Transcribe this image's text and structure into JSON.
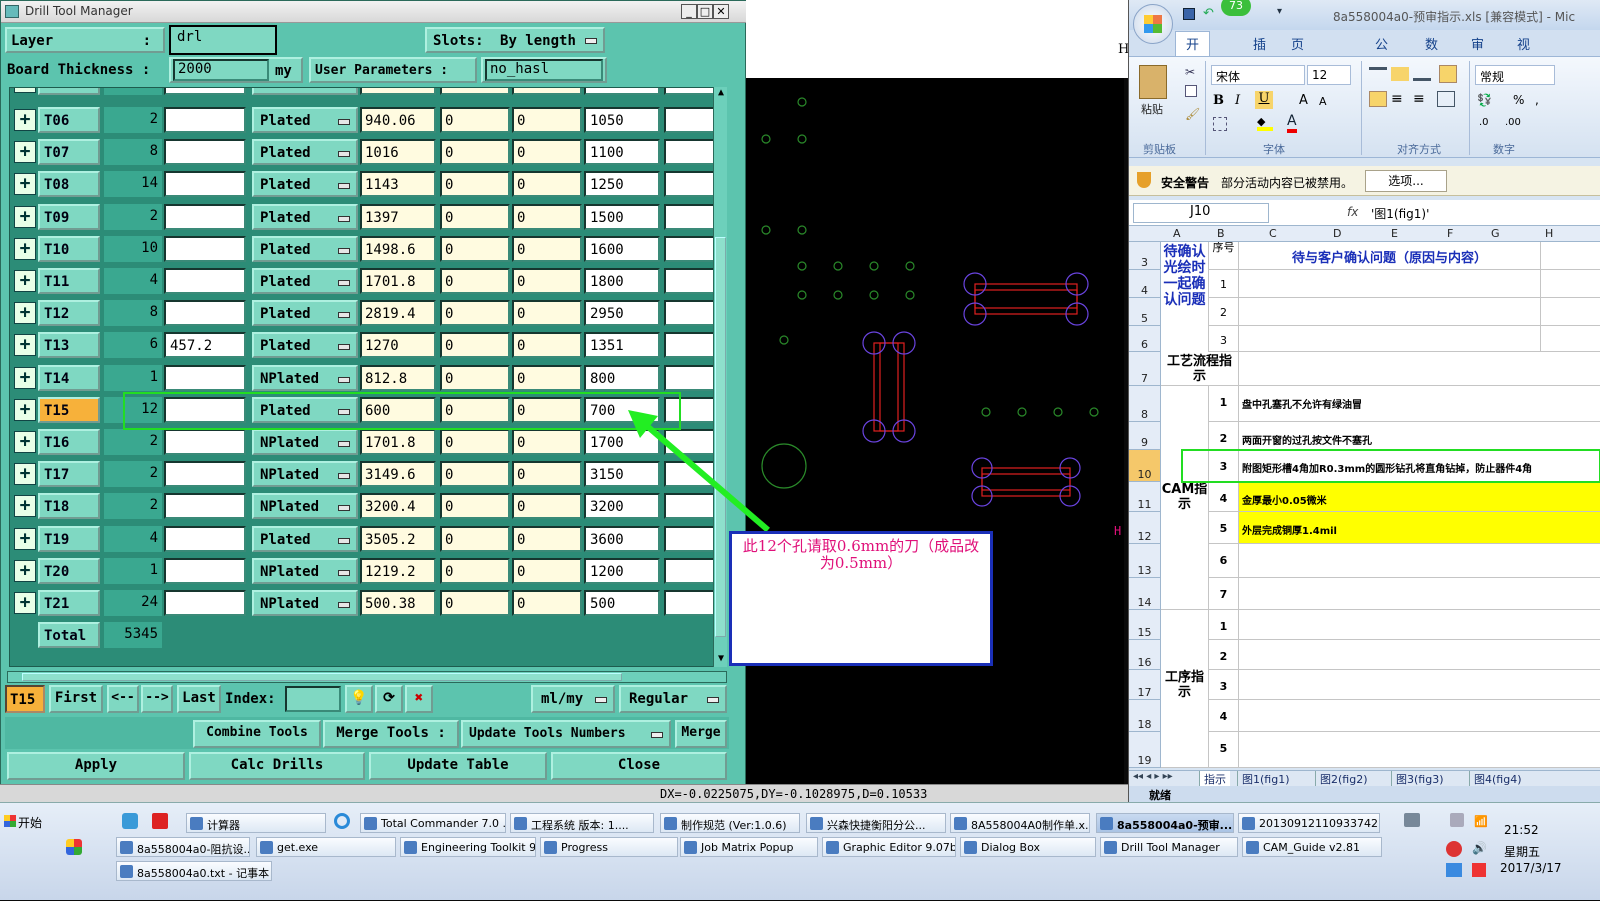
{
  "dtm": {
    "title": "Drill Tool Manager",
    "layer_label": "Layer",
    "layer_sep": ":",
    "layer_value": "drl",
    "slots_label": "Slots:",
    "slots_value": "By length",
    "board_thickness_label": "Board Thickness :",
    "board_thickness_value": "2000",
    "board_unit": "my",
    "user_params_label": "User Parameters :",
    "user_params_value": "no_hasl",
    "rows": [
      {
        "tool": "T06",
        "count": "2",
        "c1": "",
        "type": "Plated",
        "size": "940.06",
        "a": "0",
        "b": "0",
        "fin": "1050"
      },
      {
        "tool": "T07",
        "count": "8",
        "c1": "",
        "type": "Plated",
        "size": "1016",
        "a": "0",
        "b": "0",
        "fin": "1100"
      },
      {
        "tool": "T08",
        "count": "14",
        "c1": "",
        "type": "Plated",
        "size": "1143",
        "a": "0",
        "b": "0",
        "fin": "1250"
      },
      {
        "tool": "T09",
        "count": "2",
        "c1": "",
        "type": "Plated",
        "size": "1397",
        "a": "0",
        "b": "0",
        "fin": "1500"
      },
      {
        "tool": "T10",
        "count": "10",
        "c1": "",
        "type": "Plated",
        "size": "1498.6",
        "a": "0",
        "b": "0",
        "fin": "1600"
      },
      {
        "tool": "T11",
        "count": "4",
        "c1": "",
        "type": "Plated",
        "size": "1701.8",
        "a": "0",
        "b": "0",
        "fin": "1800"
      },
      {
        "tool": "T12",
        "count": "8",
        "c1": "",
        "type": "Plated",
        "size": "2819.4",
        "a": "0",
        "b": "0",
        "fin": "2950"
      },
      {
        "tool": "T13",
        "count": "6",
        "c1": "457.2",
        "type": "Plated",
        "size": "1270",
        "a": "0",
        "b": "0",
        "fin": "1351"
      },
      {
        "tool": "T14",
        "count": "1",
        "c1": "",
        "type": "NPlated",
        "size": "812.8",
        "a": "0",
        "b": "0",
        "fin": "800"
      },
      {
        "tool": "T15",
        "count": "12",
        "c1": "",
        "type": "Plated",
        "size": "600",
        "a": "0",
        "b": "0",
        "fin": "700"
      },
      {
        "tool": "T16",
        "count": "2",
        "c1": "",
        "type": "NPlated",
        "size": "1701.8",
        "a": "0",
        "b": "0",
        "fin": "1700"
      },
      {
        "tool": "T17",
        "count": "2",
        "c1": "",
        "type": "NPlated",
        "size": "3149.6",
        "a": "0",
        "b": "0",
        "fin": "3150"
      },
      {
        "tool": "T18",
        "count": "2",
        "c1": "",
        "type": "NPlated",
        "size": "3200.4",
        "a": "0",
        "b": "0",
        "fin": "3200"
      },
      {
        "tool": "T19",
        "count": "4",
        "c1": "",
        "type": "Plated",
        "size": "3505.2",
        "a": "0",
        "b": "0",
        "fin": "3600"
      },
      {
        "tool": "T20",
        "count": "1",
        "c1": "",
        "type": "NPlated",
        "size": "1219.2",
        "a": "0",
        "b": "0",
        "fin": "1200"
      },
      {
        "tool": "T21",
        "count": "24",
        "c1": "",
        "type": "NPlated",
        "size": "500.38",
        "a": "0",
        "b": "0",
        "fin": "500"
      }
    ],
    "partial_row_type": "Plated",
    "total_label": "Total",
    "total_value": "5345",
    "current_tool": "T15",
    "first": "First",
    "prev": "<--",
    "next": "-->",
    "last": "Last",
    "index_label": "Index:",
    "units": "ml/my",
    "mode": "Regular",
    "combine": "Combine Tools",
    "merge_tools": "Merge Tools :",
    "update_numbers": "Update Tools Numbers",
    "merge": "Merge",
    "apply": "Apply",
    "calc": "Calc Drills",
    "update_table": "Update Table",
    "close": "Close"
  },
  "cad": {
    "annotation": "此12个孔请取0.6mm的刀（成品改为0.5mm）",
    "side_letter_top": "H",
    "side_letter_right": "H",
    "coords": "DX=-0.0225075,DY=-0.1028975,D=0.10533"
  },
  "excel": {
    "title": "8a558004a0-预审指示.xls [兼容模式] - Mic",
    "badge": "73",
    "tabs": [
      "开始",
      "插入",
      "页面布局",
      "公式",
      "数据",
      "审阅",
      "视图"
    ],
    "paste": "粘贴",
    "clipboard": "剪贴板",
    "font_group": "字体",
    "align_group": "对齐方式",
    "number_group": "数字",
    "font_name": "宋体",
    "font_size": "12",
    "number_format": "常规",
    "security_label": "安全警告",
    "security_msg": "部分活动内容已被禁用。",
    "options_btn": "选项...",
    "name_box": "J10",
    "fx": "fx",
    "formula": "'图1(fig1)'",
    "cols": [
      "A",
      "B",
      "C",
      "D",
      "E",
      "F",
      "G",
      "H"
    ],
    "header_seq": "序号",
    "header_issue": "待与客户确认问题（原因与内容）",
    "section_confirm": "待确认光绘时一起确认问题",
    "section_flow": "工艺流程指示",
    "section_cam": "CAM指示",
    "section_proc": "工序指示",
    "rownums": [
      "3",
      "4",
      "5",
      "6",
      "7",
      "8",
      "9",
      "10",
      "11",
      "12",
      "13",
      "14",
      "15",
      "16",
      "17",
      "18",
      "19"
    ],
    "seqs": [
      "1",
      "2",
      "3",
      "1",
      "2",
      "3",
      "4",
      "5",
      "6",
      "7",
      "1",
      "2",
      "3",
      "4",
      "5"
    ],
    "notes": [
      "盘中孔塞孔不允许有绿油冒",
      "两面开窗的过孔按文件不塞孔",
      "附图矩形槽4角加R0.3mm的圆形钻孔将直角钻掉，防止器件4角",
      "金厚最小0.05微米",
      "外层完成铜厚1.4mil"
    ],
    "sheets": [
      "指示",
      "图1(fig1)",
      "图2(fig2)",
      "图3(fig3)",
      "图4(fig4)"
    ],
    "status": "就绪"
  },
  "taskbar": {
    "start": "开始",
    "row1": [
      "计算器",
      "Total Commander 7.0 ...",
      "工程系统  版本: 1....",
      "制作规范 (Ver:1.0.6)",
      "兴森快捷衡阳分公...",
      "8A558004A0制作单.x...",
      "8a558004a0-预审...",
      "20130912110933742..."
    ],
    "row2": [
      "8a558004a0-阻抗设...",
      "get.exe",
      "Engineering Toolkit 9....",
      "Progress",
      "Job Matrix Popup",
      "Graphic Editor 9.07b...",
      "Dialog Box",
      "Drill Tool Manager",
      "CAM_Guide v2.81"
    ],
    "row3": [
      "8a558004a0.txt - 记事本"
    ],
    "time": "21:52",
    "weekday": "星期五",
    "date": "2017/3/17"
  },
  "colors": {
    "panel": "#5cc4ae",
    "highlight_box": "#22dd22",
    "annotation_border": "#1a2fb8",
    "annotation_text": "#e0107a",
    "excel_yellow": "#ffff00"
  }
}
